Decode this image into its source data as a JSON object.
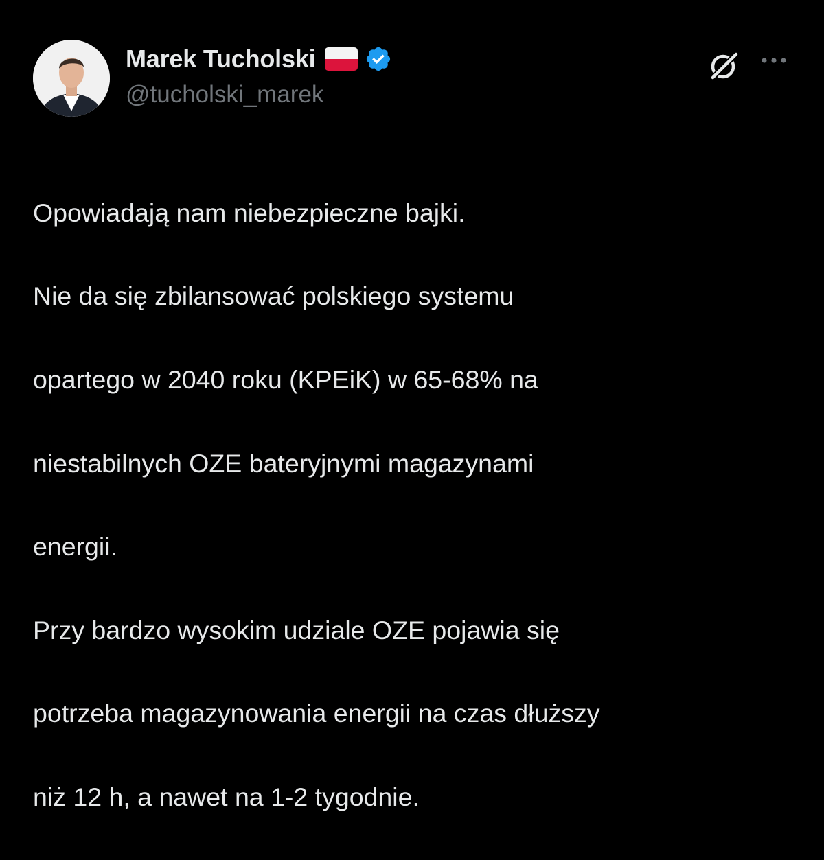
{
  "author": {
    "display_name": "Marek Tucholski",
    "handle": "@tucholski_marek",
    "flag": "poland-flag",
    "verified_icon": "verified-badge-icon",
    "verified_color": "#1d9bf0"
  },
  "actions": {
    "grok_icon": "grok-icon",
    "more_icon": "more-options-icon"
  },
  "tweet": {
    "lines": [
      "Opowiadają nam niebezpieczne bajki.",
      "Nie da się zbilansować polskiego systemu",
      "opartego w 2040 roku (KPEiK) w 65-68% na",
      "niestabilnych OZE bateryjnymi magazynami",
      "energii.",
      "Przy bardzo wysokim udziale OZE pojawia się",
      "potrzeba magazynowania energii na czas dłuższy",
      "niż 12 h, a nawet na 1-2 tygodnie."
    ]
  },
  "theme": {
    "background": "#000000",
    "text": "#e7e9ea",
    "secondary_text": "#71767b"
  }
}
